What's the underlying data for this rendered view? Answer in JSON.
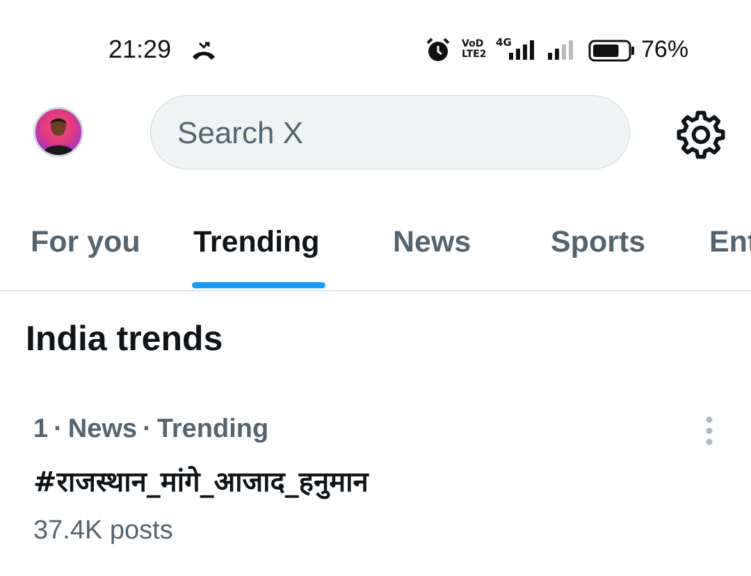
{
  "status_bar": {
    "time": "21:29",
    "volte_line1": "VoD",
    "volte_line2": "LTE2",
    "network": "4G",
    "battery_percent": "76%",
    "battery_level": 0.76,
    "icons": [
      "missed-call-icon",
      "alarm-icon",
      "signal-icon",
      "battery-icon"
    ]
  },
  "header": {
    "search_placeholder": "Search X",
    "icons": [
      "avatar",
      "settings-gear-icon"
    ]
  },
  "tabs": [
    {
      "label": "For you",
      "active": false
    },
    {
      "label": "Trending",
      "active": true
    },
    {
      "label": "News",
      "active": false
    },
    {
      "label": "Sports",
      "active": false
    },
    {
      "label": "Ent",
      "active": false
    }
  ],
  "section": {
    "title": "India trends"
  },
  "trends": [
    {
      "rank": "1",
      "category": "News",
      "status": "Trending",
      "name": "#राजस्थान_मांगे_आजाद_हनुमान",
      "posts": "37.4K posts"
    }
  ],
  "colors": {
    "accent": "#1d9bf0",
    "primary_text": "#0f1419",
    "secondary_text": "#536471",
    "search_bg": "#eff3f4",
    "border": "#cfd9de"
  }
}
